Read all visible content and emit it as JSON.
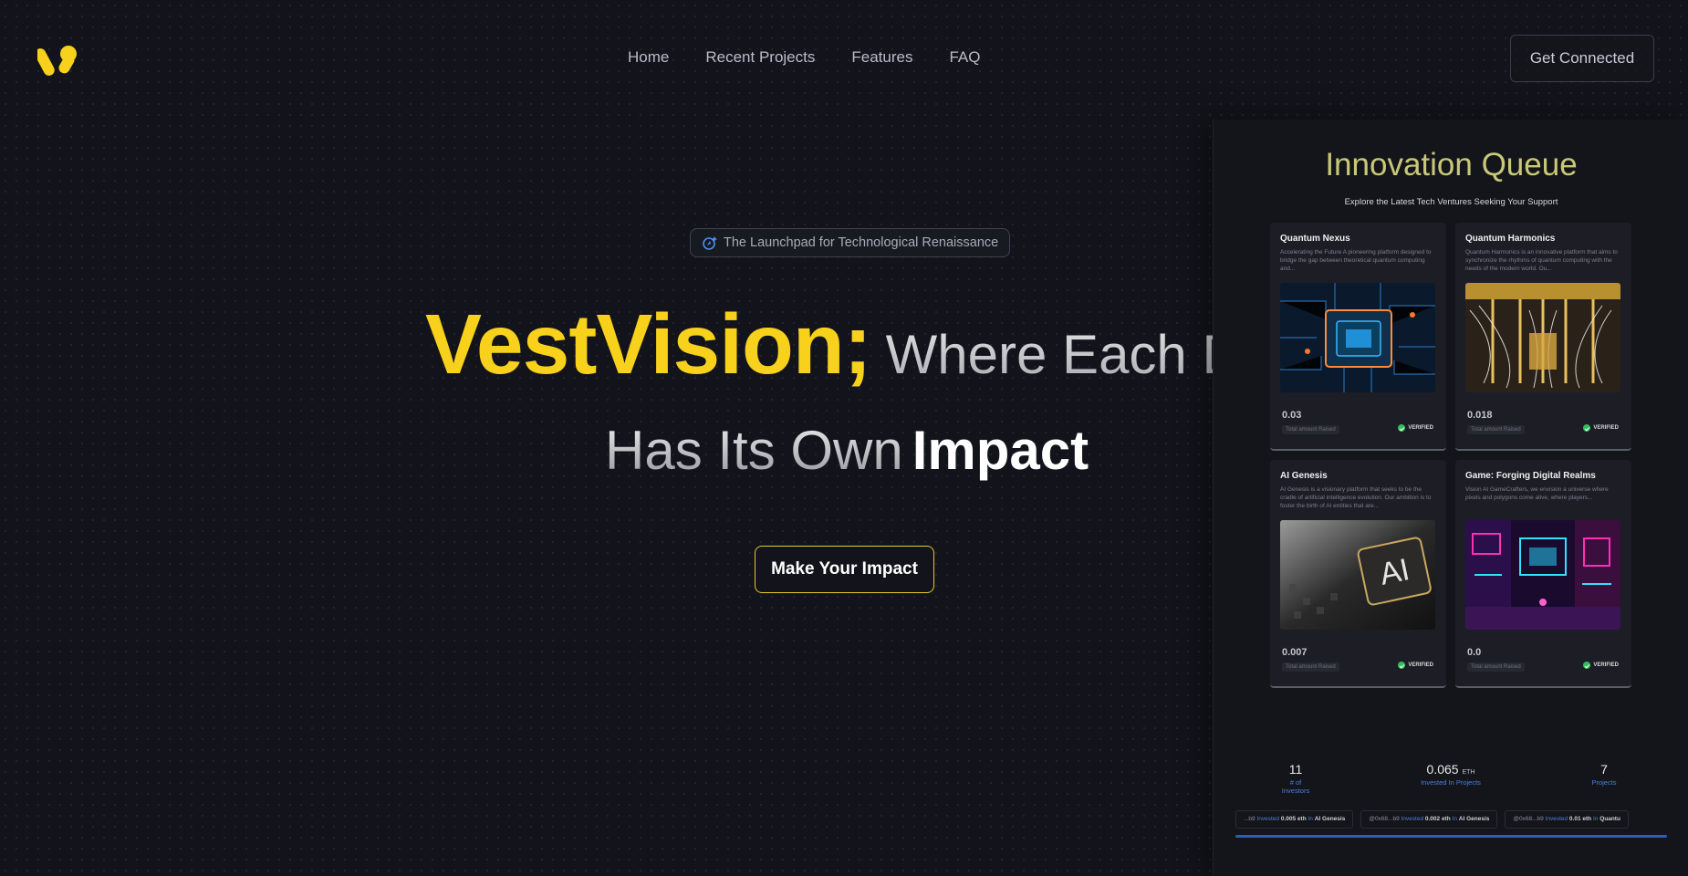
{
  "header": {
    "logo_icon": "vestvision-logo-icon",
    "nav": [
      {
        "label": "Home"
      },
      {
        "label": "Recent Projects"
      },
      {
        "label": "Features"
      },
      {
        "label": "FAQ"
      }
    ],
    "cta_label": "Get Connected"
  },
  "hero": {
    "badge_icon": "rocket-sparkle-icon",
    "badge_text": "The Launchpad for Technological Renaissance",
    "brand": "VestVision;",
    "line1_rest": "Where Each D",
    "line2_prefix": "Has Its Own",
    "line2_emphasis": "Impact",
    "cta_label": "Make Your Impact"
  },
  "panel": {
    "title": "Innovation Queue",
    "subtitle": "Explore the Latest Tech Ventures Seeking Your Support",
    "projects": [
      {
        "title": "Quantum Nexus",
        "description": "Accelerating the Future A pioneering platform designed to bridge the gap between theoretical quantum computing and...",
        "amount": "0.03",
        "amount_label": "Total amount Raised",
        "status": "VERIFIED",
        "image": "circuit-chip-image"
      },
      {
        "title": "Quantum Harmonics",
        "description": "Quantum Harmonics is an innovative platform that aims to synchronize the rhythms of quantum computing with the needs of the modern world. Ou...",
        "amount": "0.018",
        "amount_label": "Total amount Raised",
        "status": "VERIFIED",
        "image": "quantum-computer-image"
      },
      {
        "title": "AI Genesis",
        "description": "AI Genesis is a visionary platform that seeks to be the cradle of artificial intelligence evolution. Our ambition is to foster the birth of AI entities that are...",
        "amount": "0.007",
        "amount_label": "Total amount Raised",
        "status": "VERIFIED",
        "image": "ai-chip-image"
      },
      {
        "title": "Game: Forging Digital Realms",
        "description": "Vision At GameCrafters, we envision a universe where pixels and polygons come alive, where players...",
        "amount": "0.0",
        "amount_label": "Total amount Raised",
        "status": "VERIFIED",
        "image": "neon-city-image"
      }
    ],
    "stats": [
      {
        "value": "11",
        "unit": "",
        "label": "# of Investors"
      },
      {
        "value": "0.065",
        "unit": "ETH",
        "label": "Invested In Projects"
      },
      {
        "value": "7",
        "unit": "",
        "label": "Projects"
      }
    ],
    "ticker": [
      {
        "addr": "...b9",
        "verb": "Invested",
        "amount": "0.005 eth",
        "prep": "In",
        "project": "AI Genesis"
      },
      {
        "addr": "@0x68...b9",
        "verb": "Invested",
        "amount": "0.002 eth",
        "prep": "In",
        "project": "AI Genesis"
      },
      {
        "addr": "@0x68...b9",
        "verb": "Invested",
        "amount": "0.01 eth",
        "prep": "In",
        "project": "Quantu"
      }
    ],
    "colors": {
      "accent": "#f7d11b",
      "panel_title": "#c9c878",
      "link_blue": "#4d7fd6",
      "verified": "#2fbf5b"
    }
  }
}
